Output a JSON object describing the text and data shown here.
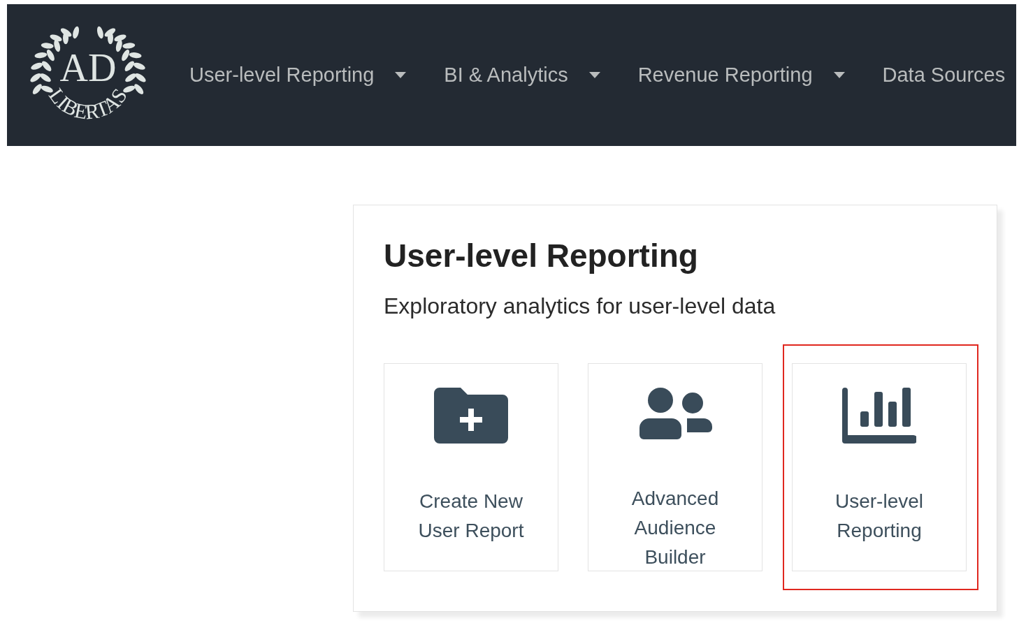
{
  "navbar": {
    "logo": {
      "top": "AD",
      "bottom": "LIBERTAS"
    },
    "items": [
      {
        "label": "User-level Reporting",
        "dropdown": true
      },
      {
        "label": "BI & Analytics",
        "dropdown": true
      },
      {
        "label": "Revenue Reporting",
        "dropdown": true
      },
      {
        "label": "Data Sources",
        "dropdown": false
      }
    ]
  },
  "panel": {
    "title": "User-level Reporting",
    "subtitle": "Exploratory analytics for user-level data",
    "cards": [
      {
        "kind": "folder-plus",
        "label": "Create New User Report",
        "highlighted": false
      },
      {
        "kind": "users",
        "label": "Advanced Audience Builder",
        "highlighted": false
      },
      {
        "kind": "bar-chart",
        "label": "User-level Reporting",
        "highlighted": true
      }
    ]
  }
}
